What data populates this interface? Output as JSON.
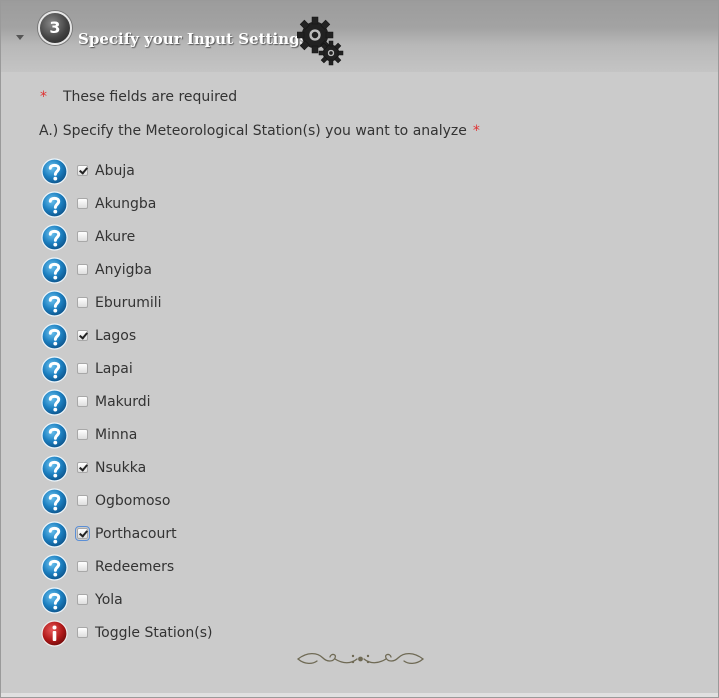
{
  "header": {
    "step_number": "3",
    "title": "Specify your Input Settings"
  },
  "required_note": {
    "marker": "*",
    "text": "These fields are required"
  },
  "question": {
    "label": "A.) Specify the Meteorological Station(s) you want to analyze",
    "marker": "*"
  },
  "stations": [
    {
      "label": "Abuja",
      "checked": true
    },
    {
      "label": "Akungba",
      "checked": false
    },
    {
      "label": "Akure",
      "checked": false
    },
    {
      "label": "Anyigba",
      "checked": false
    },
    {
      "label": "Eburumili",
      "checked": false
    },
    {
      "label": "Lagos",
      "checked": true
    },
    {
      "label": "Lapai",
      "checked": false
    },
    {
      "label": "Makurdi",
      "checked": false
    },
    {
      "label": "Minna",
      "checked": false
    },
    {
      "label": "Nsukka",
      "checked": true
    },
    {
      "label": "Ogbomoso",
      "checked": false
    },
    {
      "label": "Porthacourt",
      "checked": true,
      "focused": true
    },
    {
      "label": "Redeemers",
      "checked": false
    },
    {
      "label": "Yola",
      "checked": false
    }
  ],
  "toggle": {
    "label": "Toggle Station(s)",
    "checked": false
  },
  "icons": {
    "help": "help-question-icon",
    "info": "info-icon",
    "gears": "gears-icon",
    "ornament": "flourish-divider-icon"
  },
  "colors": {
    "panel_bg": "#cbcbcb",
    "help_blue": "#1c7fc0",
    "info_red": "#b01818",
    "required_red": "#e03030"
  }
}
